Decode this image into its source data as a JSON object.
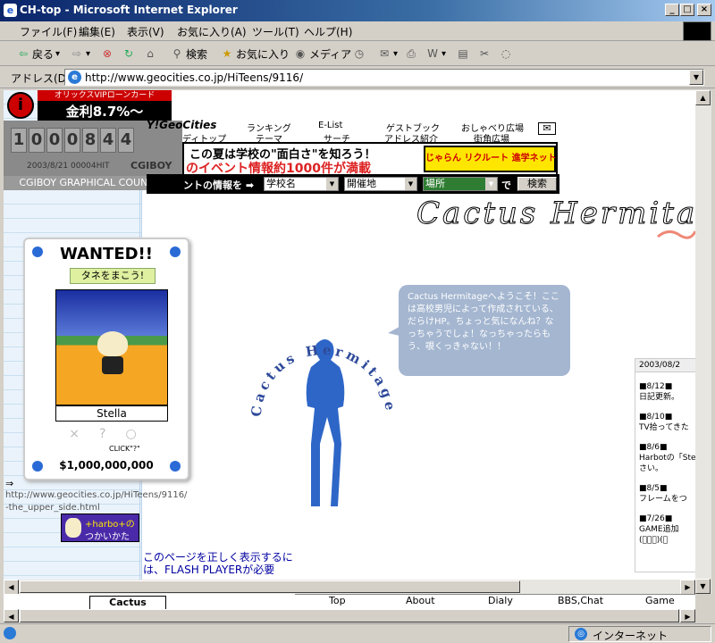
{
  "window": {
    "title": "CH-top - Microsoft Internet Explorer"
  },
  "menu": [
    "ファイル(F)",
    "編集(E)",
    "表示(V)",
    "お気に入り(A)",
    "ツール(T)",
    "ヘルプ(H)"
  ],
  "toolbar": {
    "back": "戻る",
    "search": "検索",
    "favorites": "お気に入り",
    "media": "メディア"
  },
  "address": {
    "label": "アドレス(D)",
    "url": "http://www.geocities.co.jp/HiTeens/9116/"
  },
  "ad": {
    "orix_line1": "オリックスVIPローンカード",
    "orix_line2": "金利8.7%〜"
  },
  "counter": {
    "digits": [
      "1",
      "0",
      "0",
      "0",
      "8",
      "4",
      "4"
    ],
    "date": "2003/8/21  00004HIT",
    "brand": "CGIBOY",
    "caption": "CGIBOY GRAPHICAL COUNTER"
  },
  "geocities": {
    "logo": "Y!GeoCities",
    "links_top": [
      "ランキング",
      "E-List",
      "ゲストブック",
      "おしゃべり広場"
    ],
    "links_bottom": [
      "ディトップ",
      "テーマ",
      "サーチ",
      "アドレス紹介",
      "街角広場"
    ]
  },
  "event": {
    "line1": "この夏は学校の\"面白さ\"を知ろう！",
    "line2": "のイベント情報約1000件が満載",
    "brand": "じゃらん リクルート 進学ネット"
  },
  "search": {
    "label": "ントの情報を ➡",
    "selects": [
      "学校名",
      "開催地",
      "場所"
    ],
    "de": "で",
    "button": "検索"
  },
  "site_title": "Cactus Hermitage",
  "wanted": {
    "title": "WANTED!!",
    "tag": "タネをまこう!",
    "name": "Stella",
    "click": "CLICK\"?\"",
    "bounty": "$1,000,000,000"
  },
  "bubble": "Cactus Hermitageへようこそ！ここは高校男児によって作成されている、だらけHP。ちょっと気になんね？なっちゃうでしょ！なっちゃったらもう、覗くっきゃない！！",
  "circle_text": "Cactus Hermitage",
  "diary": {
    "header": "2003/08/2",
    "entries": [
      "■8/12■",
      "日記更新。",
      "■8/10■",
      "TV拾ってきた",
      "■8/6■",
      "Harbotの「Ste",
      "さい。",
      "■8/5■",
      "フレームをつ",
      "■7/26■",
      "GAME追加",
      "(ﾟーﾟ)(。"
    ]
  },
  "link_text": {
    "arrow": "⇒",
    "line1": "http://www.geocities.co.jp/HiTeens/9116/",
    "line2": "-the_upper_side.html"
  },
  "harbot": {
    "line1": "+harbo+の",
    "line2": "つかいかた"
  },
  "notice": {
    "line1": "このページを正しく表示するに",
    "line2": "は、FLASH PLAYERが必要"
  },
  "cactus_logo": "Cactus",
  "nav": [
    "Top",
    "About",
    "Dialy",
    "BBS,Chat",
    "Game"
  ],
  "status": {
    "zone": "インターネット"
  },
  "colors": {
    "titlebar": "#0a246a",
    "bubble": "#a4b6d0",
    "figure": "#2e66c8"
  }
}
